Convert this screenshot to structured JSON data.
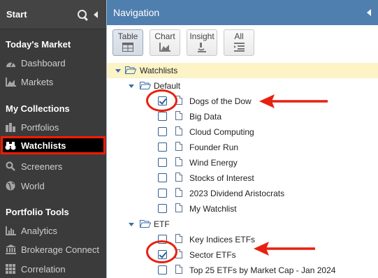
{
  "sidebar": {
    "title": "Start",
    "sections": [
      {
        "label": "Today's Market",
        "items": [
          {
            "label": "Dashboard",
            "icon": "dashboard-icon"
          },
          {
            "label": "Markets",
            "icon": "markets-chart-icon"
          }
        ]
      },
      {
        "label": "My Collections",
        "items": [
          {
            "label": "Portfolios",
            "icon": "portfolio-icon"
          },
          {
            "label": "Watchlists",
            "icon": "binoculars-icon",
            "active": true
          },
          {
            "label": "Screeners",
            "icon": "search-icon"
          },
          {
            "label": "World",
            "icon": "globe-icon"
          }
        ]
      },
      {
        "label": "Portfolio Tools",
        "items": [
          {
            "label": "Analytics",
            "icon": "analytics-icon"
          },
          {
            "label": "Brokerage Connect",
            "icon": "bank-icon"
          },
          {
            "label": "Correlation",
            "icon": "grid-icon"
          }
        ]
      }
    ]
  },
  "nav": {
    "title": "Navigation",
    "toolbar": [
      {
        "label": "Table",
        "icon": "table-icon",
        "active": true
      },
      {
        "label": "Chart",
        "icon": "chart-icon"
      },
      {
        "label": "Insight",
        "icon": "microscope-icon"
      },
      {
        "label": "All",
        "icon": "list-icon"
      }
    ],
    "tree": {
      "root": "Watchlists",
      "groups": [
        {
          "label": "Default",
          "items": [
            {
              "label": "Dogs of the Dow",
              "checked": true
            },
            {
              "label": "Big Data",
              "checked": false
            },
            {
              "label": "Cloud Computing",
              "checked": false
            },
            {
              "label": "Founder Run",
              "checked": false
            },
            {
              "label": "Wind Energy",
              "checked": false
            },
            {
              "label": "Stocks of Interest",
              "checked": false
            },
            {
              "label": "2023 Dividend Aristocrats",
              "checked": false
            },
            {
              "label": "My Watchlist",
              "checked": false
            }
          ]
        },
        {
          "label": "ETF",
          "items": [
            {
              "label": "Key Indices ETFs",
              "checked": false
            },
            {
              "label": "Sector ETFs",
              "checked": true
            },
            {
              "label": "Top 25 ETFs by Market Cap - Jan 2024",
              "checked": false
            }
          ]
        }
      ]
    }
  },
  "colors": {
    "annotation": "#e8200f",
    "header": "#4f7fae",
    "sidebar": "#3b3b3b"
  }
}
